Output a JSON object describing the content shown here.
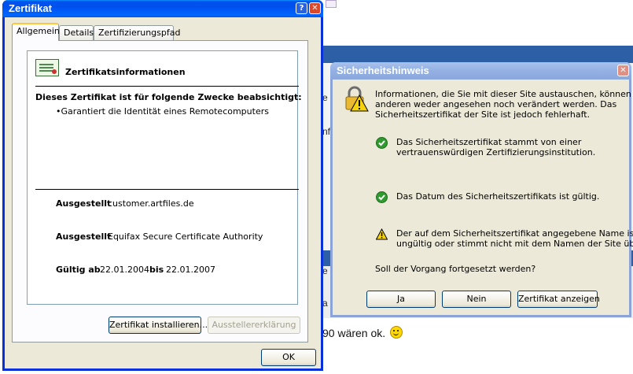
{
  "background": {
    "text": "90 wären ok.",
    "fragments": [
      "e",
      "nf",
      "e",
      "a"
    ]
  },
  "certificate_window": {
    "title": "Zertifikat",
    "help_label": "?",
    "close_label": "✕",
    "tabs": [
      {
        "label": "Allgemein"
      },
      {
        "label": "Details"
      },
      {
        "label": "Zertifizierungspfad"
      }
    ],
    "info_title": "Zertifikatsinformationen",
    "purpose_heading": "Dieses Zertifikat ist für folgende Zwecke beabsichtigt:",
    "purposes": [
      "•Garantiert die Identität eines Remotecomputers"
    ],
    "issued_to_label": "Ausgestellt",
    "issued_to_value": "customer.artfiles.de",
    "issued_by_label": "Ausgestellt",
    "issued_by_value": "Equifax Secure Certificate Authority",
    "valid_from_label": "Gültig ab",
    "valid_from_value": "22.01.2004",
    "valid_to_label": "bis",
    "valid_to_value": "22.01.2007",
    "install_button": "Zertifikat installieren...",
    "issuer_statement_button": "Ausstellererklärung",
    "ok_button": "OK"
  },
  "security_dialog": {
    "title": "Sicherheitshinweis",
    "close_label": "✕",
    "intro_lines": [
      "Informationen, die Sie mit dieser Site austauschen, können von",
      "anderen weder angesehen noch verändert werden. Das",
      "Sicherheitszertifikat der Site ist jedoch fehlerhaft."
    ],
    "checks": [
      {
        "status": "ok",
        "lines": [
          "Das Sicherheitszertifikat stammt von einer",
          "vertrauenswürdigen Zertifizierungsinstitution."
        ]
      },
      {
        "status": "ok",
        "lines": [
          "Das Datum des Sicherheitszertifikats ist gültig."
        ]
      },
      {
        "status": "warning",
        "lines": [
          "Der auf dem Sicherheitszertifikat angegebene Name ist",
          "ungültig oder stimmt nicht mit dem Namen der Site überein."
        ]
      }
    ],
    "question": "Soll der Vorgang fortgesetzt werden?",
    "yes_button": "Ja",
    "no_button": "Nein",
    "view_button": "Zertifikat anzeigen"
  },
  "colors": {
    "xp_title_blue": "#0053ee",
    "inactive_title": "#94b0e3",
    "dialog_face": "#ece9d8",
    "ok_green": "#2f9b2f",
    "warn_yellow": "#f5d20a"
  }
}
